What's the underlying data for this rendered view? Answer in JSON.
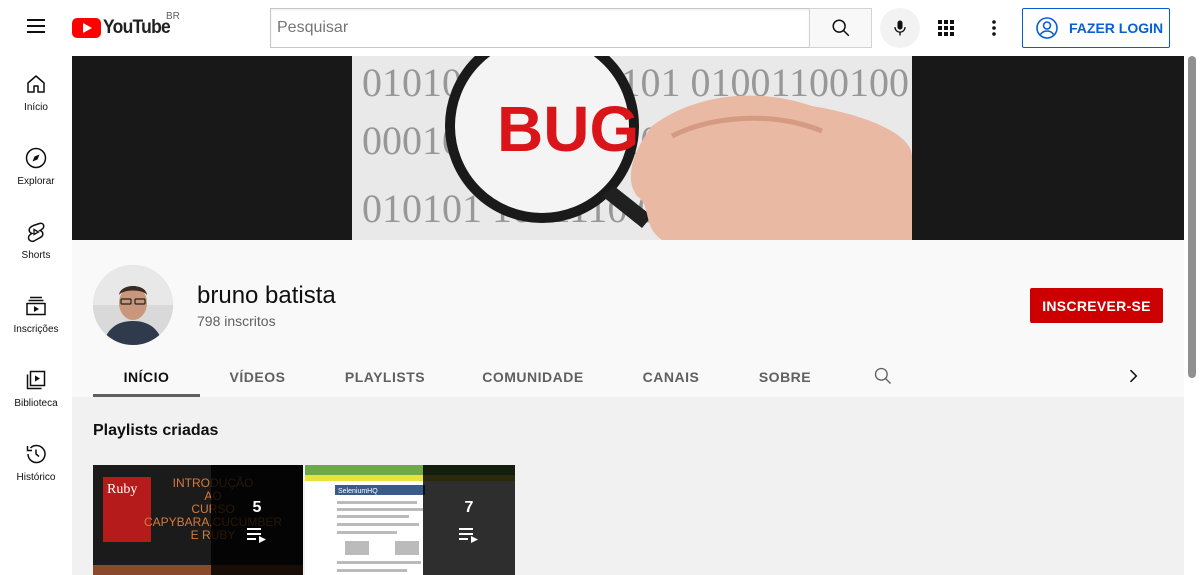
{
  "header": {
    "logo_text": "YouTube",
    "country_code": "BR",
    "search_placeholder": "Pesquisar",
    "login_label": "FAZER LOGIN"
  },
  "sidebar": {
    "items": [
      {
        "label": "Início",
        "icon": "home-icon"
      },
      {
        "label": "Explorar",
        "icon": "compass-icon"
      },
      {
        "label": "Shorts",
        "icon": "shorts-icon"
      },
      {
        "label": "Inscrições",
        "icon": "subscriptions-icon"
      },
      {
        "label": "Biblioteca",
        "icon": "library-icon"
      },
      {
        "label": "Histórico",
        "icon": "history-icon"
      }
    ]
  },
  "banner": {
    "text": "BUG",
    "binary_rows": [
      "0101011 01 000101 0100110010011",
      "000101 01 0001101 0001011",
      "010101 1011110 0110111 0111"
    ]
  },
  "channel": {
    "name": "bruno batista",
    "subscribers": "798 inscritos",
    "subscribe_label": "INSCREVER-SE"
  },
  "tabs": [
    {
      "label": "INÍCIO",
      "active": true
    },
    {
      "label": "VÍDEOS",
      "active": false
    },
    {
      "label": "PLAYLISTS",
      "active": false
    },
    {
      "label": "COMUNIDADE",
      "active": false
    },
    {
      "label": "CANAIS",
      "active": false
    },
    {
      "label": "SOBRE",
      "active": false
    }
  ],
  "content": {
    "section_title": "Playlists criadas",
    "playlists": [
      {
        "count": "5",
        "thumb_text": "INTRODUÇÃO AO CURSO CAPYBARA,CUCUMBER E RUBY",
        "thumb_badge": "Ruby"
      },
      {
        "count": "7",
        "thumb_text": "SeleniumHQ",
        "thumb_badge": ""
      }
    ]
  },
  "colors": {
    "brand_red": "#ff0000",
    "subscribe_red": "#cc0000",
    "link_blue": "#065fd4"
  }
}
